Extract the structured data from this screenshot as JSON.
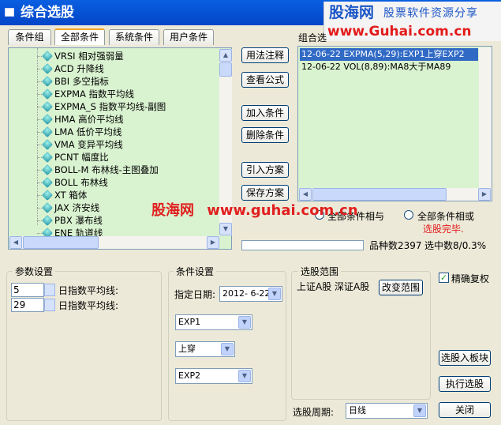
{
  "window": {
    "title": "综合选股"
  },
  "brand": {
    "name": "股海网",
    "tagline": "股票软件资源分享",
    "url": "www.Guhai.com.cn"
  },
  "tabs": [
    {
      "label": "条件组"
    },
    {
      "label": "全部条件"
    },
    {
      "label": "系统条件"
    },
    {
      "label": "用户条件"
    }
  ],
  "indicators": [
    "VRSI 相对强弱量",
    "ACD 升降线",
    "BBI 多空指标",
    "EXPMA 指数平均线",
    "EXPMA_S 指数平均线-副图",
    "HMA 高价平均线",
    "LMA 低价平均线",
    "VMA 变异平均线",
    "PCNT 幅度比",
    "BOLL-M 布林线-主图叠加",
    "BOLL 布林线",
    "XT 箱体",
    "JAX 济安线",
    "PBX 瀑布线",
    "ENE 轨道线"
  ],
  "actions": {
    "usage": "用法注释",
    "formula": "查看公式",
    "add": "加入条件",
    "delete": "删除条件",
    "import": "引入方案",
    "save": "保存方案"
  },
  "conditions": {
    "label": "组合选",
    "items": [
      "12-06-22 EXPMA(5,29):EXP1上穿EXP2",
      "12-06-22 VOL(8,89):MA8大于MA89"
    ]
  },
  "logic": {
    "and_label": "全部条件相与",
    "or_label": "全部条件相或"
  },
  "status": {
    "done": "选股完毕.",
    "count_label": "品种数",
    "count": "2397",
    "selected_label": "选中数",
    "selected": "8/0.3%"
  },
  "params": {
    "title": "参数设置",
    "rows": [
      {
        "value": "5",
        "label": "日指数平均线:"
      },
      {
        "value": "29",
        "label": "日指数平均线:"
      }
    ]
  },
  "condset": {
    "title": "条件设置",
    "date_label": "指定日期:",
    "date_value": "2012- 6-22",
    "left": "EXP1",
    "op": "上穿",
    "right": "EXP2"
  },
  "range": {
    "title": "选股范围",
    "value": "上证A股 深证A股",
    "change_button": "改变范围",
    "period_label": "选股周期:",
    "period_value": "日线"
  },
  "options": {
    "adjust_label": "精确复权",
    "adjust_checked": true
  },
  "bottom_buttons": {
    "to_block": "选股入板块",
    "run": "执行选股",
    "close": "关闭"
  },
  "watermark": {
    "cn": "股海网",
    "url": "www.guhai.com.cn"
  },
  "colors": {
    "title_bar": "#0a5fe0",
    "list_bg": "#d9f2d0",
    "selection": "#316ac5",
    "status_red": "#e31b1b"
  }
}
